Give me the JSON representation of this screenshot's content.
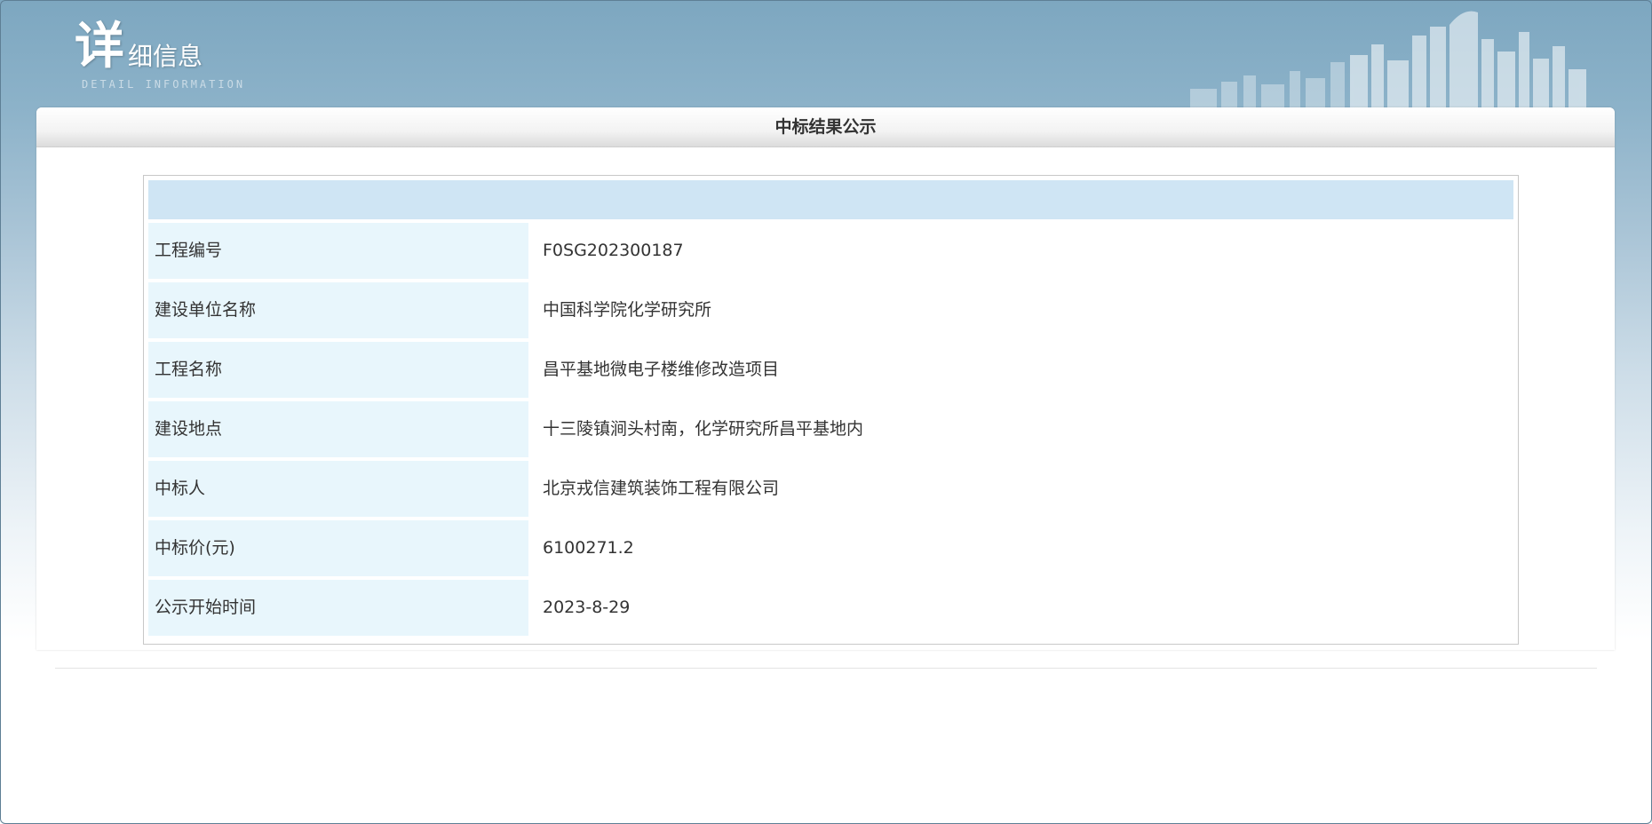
{
  "header": {
    "logo_big_char": "详",
    "logo_title": "细信息",
    "logo_subtitle": "DETAIL INFORMATION"
  },
  "panel": {
    "title": "中标结果公示"
  },
  "details": [
    {
      "label": "工程编号",
      "value": "F0SG202300187"
    },
    {
      "label": "建设单位名称",
      "value": "中国科学院化学研究所"
    },
    {
      "label": "工程名称",
      "value": "昌平基地微电子楼维修改造项目"
    },
    {
      "label": "建设地点",
      "value": "十三陵镇涧头村南，化学研究所昌平基地内"
    },
    {
      "label": "中标人",
      "value": "北京戎信建筑装饰工程有限公司"
    },
    {
      "label": "中标价(元)",
      "value": "6100271.2"
    },
    {
      "label": "公示开始时间",
      "value": "2023-8-29"
    }
  ],
  "colors": {
    "header_bar": "#cfe5f4",
    "label_bg": "#e8f6fc",
    "text": "#333333"
  }
}
